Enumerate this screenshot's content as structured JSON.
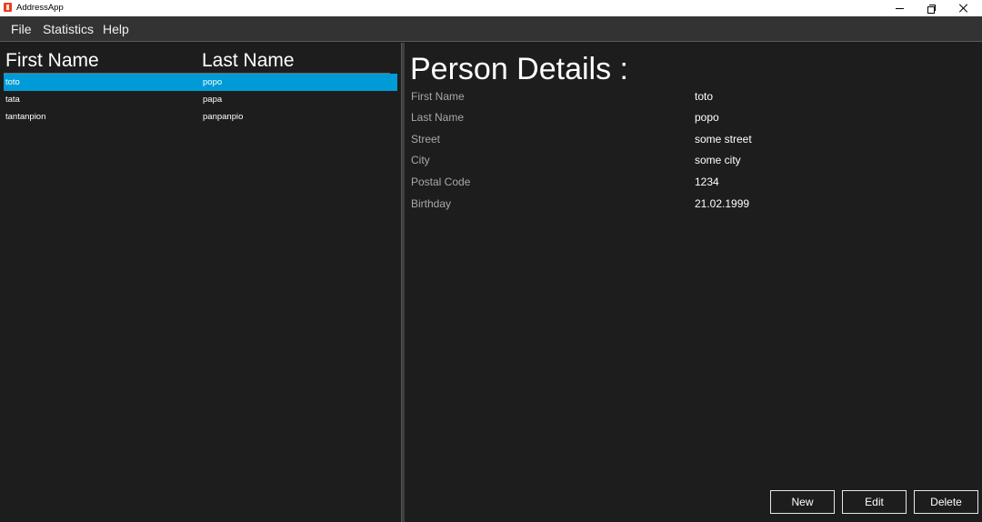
{
  "window": {
    "title": "AddressApp",
    "icon": "app-icon"
  },
  "menu": {
    "items": [
      "File",
      "Statistics",
      "Help"
    ]
  },
  "table": {
    "headers": [
      "First Name",
      "Last Name"
    ],
    "rows": [
      {
        "first": "toto",
        "last": "popo",
        "selected": true
      },
      {
        "first": "tata",
        "last": "papa",
        "selected": false
      },
      {
        "first": "tantanpion",
        "last": "panpanpio",
        "selected": false
      }
    ],
    "selection_color": "#009bd6"
  },
  "details": {
    "title": "Person Details :",
    "fields": [
      {
        "label": "First Name",
        "value": "toto"
      },
      {
        "label": "Last Name",
        "value": "popo"
      },
      {
        "label": "Street",
        "value": "some street"
      },
      {
        "label": "City",
        "value": "some city"
      },
      {
        "label": "Postal Code",
        "value": "1234"
      },
      {
        "label": "Birthday",
        "value": "21.02.1999"
      }
    ]
  },
  "buttons": {
    "new": "New",
    "edit": "Edit",
    "delete": "Delete"
  },
  "theme": {
    "background": "#1d1d1d",
    "menubar": "#333333",
    "accent": "#009bd6"
  }
}
